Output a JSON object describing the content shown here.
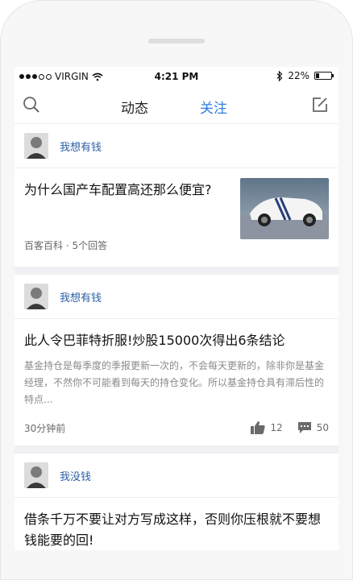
{
  "status_bar": {
    "carrier": "VIRGIN",
    "time": "4:21 PM",
    "battery": "22%"
  },
  "nav": {
    "tabs": [
      "动态",
      "关注"
    ],
    "active_tab": "关注",
    "icons": {
      "left": "search-icon",
      "right": "compose-icon"
    }
  },
  "feed": [
    {
      "author": "我想有钱",
      "title": "为什么国产车配置高还那么便宜?",
      "meta": "百客百科 · 5个回答"
    },
    {
      "author": "我想有钱",
      "title": "此人令巴菲特折服!炒股15000次得出6条结论",
      "excerpt": "基金持仓是每季度的季报更新一次的，不会每天更新的，除非你是基金经理，不然你不可能看到每天的持仓变化。所以基金持仓具有滞后性的特点...",
      "time": "30分钟前",
      "likes": "12",
      "comments": "50"
    },
    {
      "author": "我没钱",
      "title": "借条千万不要让对方写成这样，否则你压根就不要想钱能要的回!"
    }
  ],
  "colors": {
    "accent": "#2f7fe0",
    "author": "#2a5fa6",
    "muted": "#8a8a8a"
  }
}
